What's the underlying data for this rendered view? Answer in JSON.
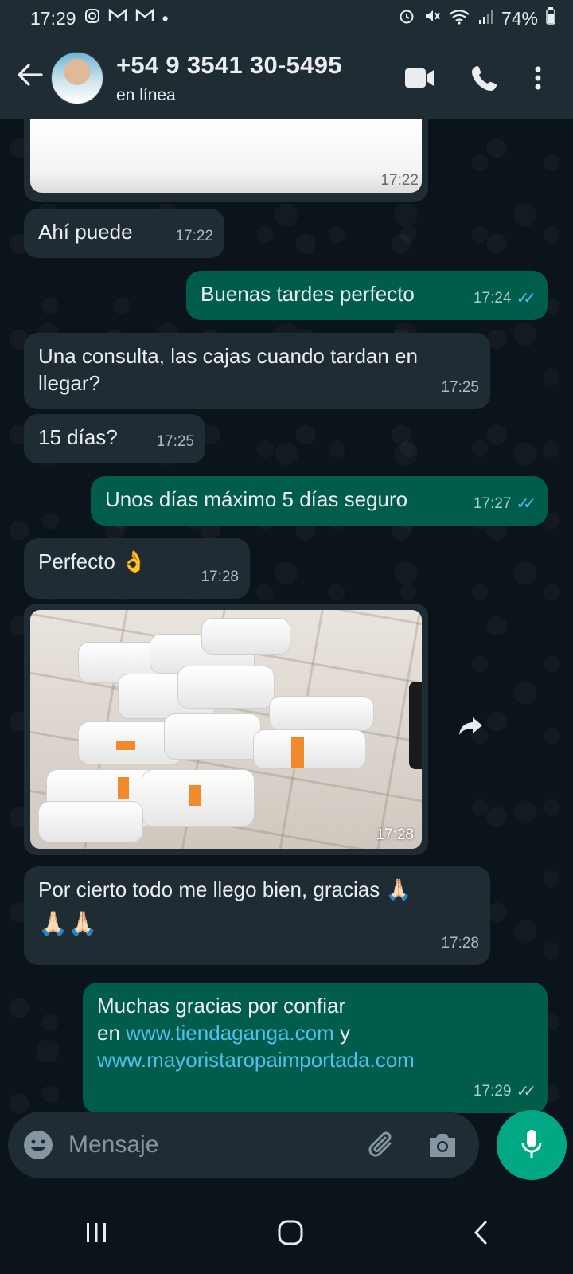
{
  "status_bar": {
    "time": "17:29",
    "notif_icons": [
      "instagram-icon",
      "gmail-icon",
      "gmail-icon"
    ],
    "dot": "•",
    "battery": "74%"
  },
  "header": {
    "contact_name": "+54 9 3541 30-5495",
    "status": "en línea",
    "icons": [
      "back-arrow-icon",
      "video-call-icon",
      "phone-icon",
      "more-vert-icon"
    ]
  },
  "messages": [
    {
      "type": "image-partial",
      "direction": "in",
      "time": "17:22"
    },
    {
      "type": "text",
      "direction": "in",
      "text": "Ahí puede",
      "time": "17:22"
    },
    {
      "type": "text",
      "direction": "out",
      "text": "Buenas tardes perfecto",
      "time": "17:24",
      "status": "read"
    },
    {
      "type": "text",
      "direction": "in",
      "text": "Una consulta, las cajas cuando tardan en llegar?",
      "time": "17:25"
    },
    {
      "type": "text",
      "direction": "in",
      "text": "15 días?",
      "time": "17:25"
    },
    {
      "type": "text",
      "direction": "out",
      "text": "Unos días máximo 5 días seguro",
      "time": "17:27",
      "status": "read"
    },
    {
      "type": "text",
      "direction": "in",
      "text": "Perfecto 👌",
      "time": "17:28"
    },
    {
      "type": "image",
      "direction": "in",
      "time": "17:28"
    },
    {
      "type": "text",
      "direction": "in",
      "text": "Por cierto todo me llego bien, gracias 🙏🏻",
      "text2": "🙏🏻🙏🏻",
      "time": "17:28"
    },
    {
      "type": "text",
      "direction": "out",
      "text_prefix": "Muchas gracias por confiar",
      "text_en": "en",
      "link1": "www.tiendaganga.com",
      "text_y": "y",
      "link2": "www.mayoristaropaimportada.com",
      "time": "17:29",
      "status": "delivered"
    }
  ],
  "input": {
    "placeholder": "Mensaje",
    "icons": [
      "emoji-icon",
      "attach-icon",
      "camera-icon",
      "mic-icon"
    ]
  },
  "colors": {
    "header_bg": "#1f2c34",
    "chat_bg": "#0b141a",
    "incoming_bubble": "#202c33",
    "outgoing_bubble": "#005c4b",
    "accent": "#00a884",
    "link": "#53bdeb"
  }
}
